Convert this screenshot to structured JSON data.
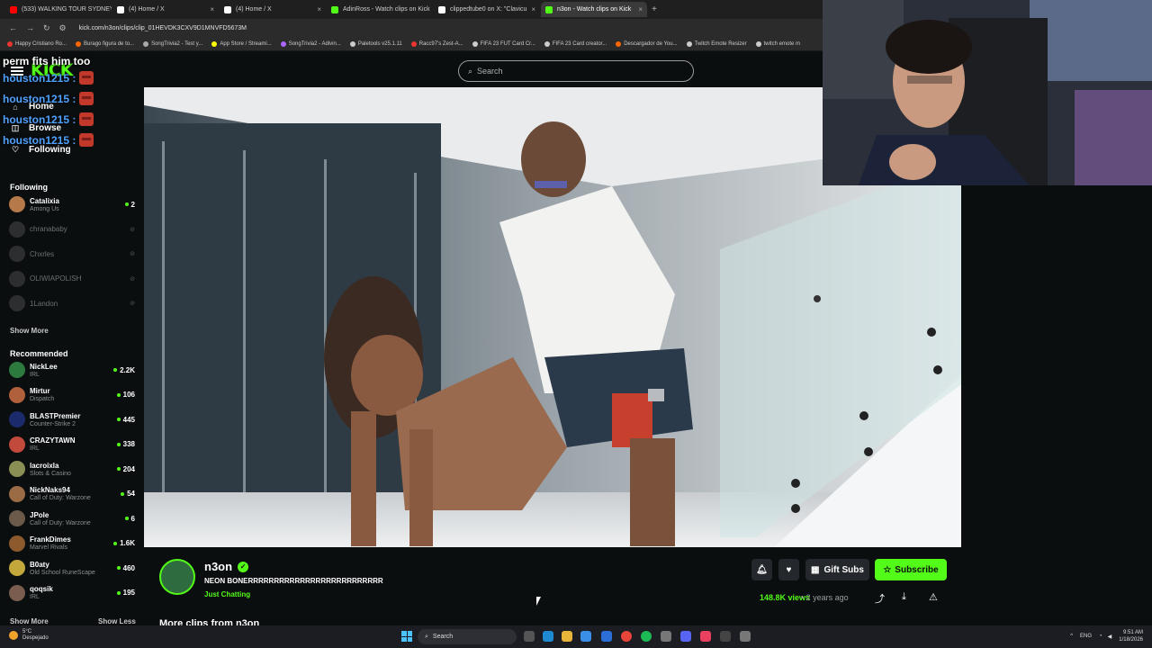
{
  "browser": {
    "tabs": [
      {
        "label": "(533) WALKING TOUR SYDNEY",
        "color": "#ff0000",
        "active": false
      },
      {
        "label": "(4) Home / X",
        "color": "#ffffff",
        "active": false
      },
      {
        "label": "(4) Home / X",
        "color": "#ffffff",
        "active": false
      },
      {
        "label": "AdinRoss - Watch clips on Kick",
        "color": "#53fc18",
        "active": false
      },
      {
        "label": "clippedtube0 on X: \"Clavicu",
        "color": "#ffffff",
        "active": false
      },
      {
        "label": "n3on - Watch clips on Kick",
        "color": "#53fc18",
        "active": true
      }
    ],
    "url": "kick.com/n3on/clips/clip_01HEVDK3CXV9D1MNVFD5673M",
    "bookmarks": [
      {
        "label": "Happy Cristiano Ro...",
        "color": "#e33"
      },
      {
        "label": "Burago figura de to...",
        "color": "#f60"
      },
      {
        "label": "SongTrivia2 - Test y...",
        "color": "#aaa"
      },
      {
        "label": "App Store / Streami...",
        "color": "#ff0"
      },
      {
        "label": "SongTrivia2 - Adivin...",
        "color": "#a6f"
      },
      {
        "label": "Paletools v25.1.11",
        "color": "#ccc"
      },
      {
        "label": "Racc97's Zest-A...",
        "color": "#e33"
      },
      {
        "label": "FIFA 23 FUT Card Cr...",
        "color": "#ccc"
      },
      {
        "label": "FIFA 23 Card creator...",
        "color": "#ccc"
      },
      {
        "label": "Descargador de You...",
        "color": "#f60"
      },
      {
        "label": "Twitch Emote Resizer",
        "color": "#ccc"
      },
      {
        "label": "twitch emote m",
        "color": "#ccc"
      }
    ]
  },
  "kick": {
    "logo": "KICK",
    "search_placeholder": "Search",
    "nav": {
      "home": "Home",
      "browse": "Browse",
      "following": "Following"
    },
    "following_heading": "Following",
    "following": [
      {
        "name": "Catalixia",
        "category": "Among Us",
        "count": "2",
        "online": true,
        "color": "#b5794a"
      },
      {
        "name": "chranababy",
        "category": "",
        "count": "",
        "online": false,
        "color": "#444"
      },
      {
        "name": "Chxrles",
        "category": "",
        "count": "",
        "online": false,
        "color": "#444"
      },
      {
        "name": "OLIWIAPOLISH",
        "category": "",
        "count": "",
        "online": false,
        "color": "#444"
      },
      {
        "name": "1Landon",
        "category": "",
        "count": "",
        "online": false,
        "color": "#444"
      }
    ],
    "show_more_following": "Show More",
    "recommended_heading": "Recommended",
    "recommended": [
      {
        "name": "NickLee",
        "category": "IRL",
        "count": "2.2K",
        "color": "#2d7a3e"
      },
      {
        "name": "Mirtur",
        "category": "Dispatch",
        "count": "106",
        "color": "#b0603a"
      },
      {
        "name": "BLASTPremier",
        "category": "Counter-Strike 2",
        "count": "445",
        "color": "#1b2a6b"
      },
      {
        "name": "CRAZYTAWN",
        "category": "IRL",
        "count": "338",
        "color": "#c24a3c"
      },
      {
        "name": "lacroixla",
        "category": "Slots & Casino",
        "count": "204",
        "color": "#8a8f55"
      },
      {
        "name": "NickNaks94",
        "category": "Call of Duty: Warzone",
        "count": "54",
        "color": "#9a6b45"
      },
      {
        "name": "JPole",
        "category": "Call of Duty: Warzone",
        "count": "6",
        "color": "#6b5a4a"
      },
      {
        "name": "FrankDimes",
        "category": "Marvel Rivals",
        "count": "1.6K",
        "color": "#8c5a2d"
      },
      {
        "name": "B0aty",
        "category": "Old School RuneScape",
        "count": "460",
        "color": "#c2a83a"
      },
      {
        "name": "qoqsik",
        "category": "IRL",
        "count": "195",
        "color": "#7a5d4f"
      }
    ],
    "show_more_rec": "Show More",
    "show_less_rec": "Show Less",
    "chat_overlay": {
      "line1": "perm fits him too",
      "users": [
        "houston1215 :",
        "houston1215 :",
        "houston1215 :",
        "houston1215 :"
      ]
    },
    "clip": {
      "streamer": "n3on",
      "title": "NEON BONERRRRRRRRRRRRRRRRRRRRRRRRRR",
      "category": "Just Chatting",
      "views": "148.8K views",
      "age": "• 2 years ago",
      "gift_label": "Gift Subs",
      "subscribe_label": "Subscribe",
      "more_clips": "More clips from n3on"
    }
  },
  "taskbar": {
    "weather_temp": "5°C",
    "weather_desc": "Despejado",
    "search": "Search",
    "lang": "ENG",
    "time": "9:51 AM",
    "date": "1/18/2026"
  }
}
